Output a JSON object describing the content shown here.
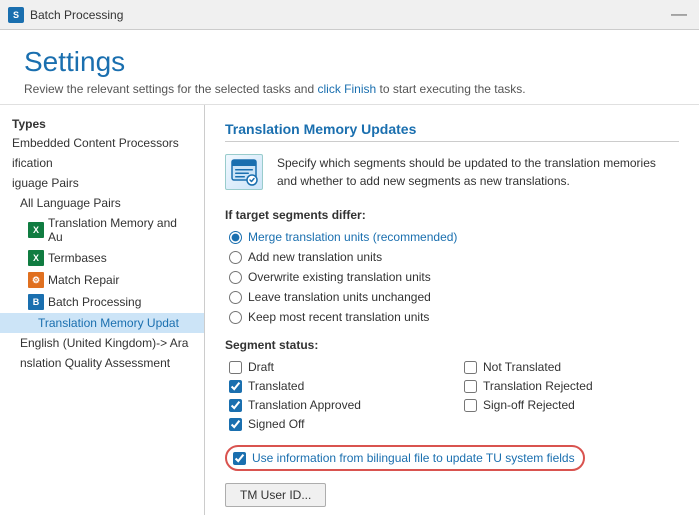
{
  "titlebar": {
    "icon_text": "S",
    "title": "Batch Processing",
    "close_label": "—"
  },
  "header": {
    "title": "Settings",
    "description_prefix": "Review the relevant settings for the selected tasks and ",
    "description_link": "click Finish",
    "description_suffix": " to start executing the tasks."
  },
  "sidebar": {
    "section_header": "Types",
    "items": [
      {
        "id": "embedded",
        "label": "Embedded Content Processors",
        "icon": "none",
        "indent": 0
      },
      {
        "id": "verification",
        "label": "ification",
        "icon": "none",
        "indent": 0
      },
      {
        "id": "language-pairs",
        "label": "iguage Pairs",
        "icon": "none",
        "indent": 0
      },
      {
        "id": "all-language-pairs",
        "label": "All Language Pairs",
        "icon": "none",
        "indent": 4
      },
      {
        "id": "tm-and-au",
        "label": "Translation Memory and Au",
        "icon": "excel",
        "indent": 8
      },
      {
        "id": "termbases",
        "label": "Termbases",
        "icon": "excel",
        "indent": 8
      },
      {
        "id": "match-repair",
        "label": "Match Repair",
        "icon": "orange",
        "indent": 8
      },
      {
        "id": "batch-processing",
        "label": "Batch Processing",
        "icon": "blue",
        "indent": 8
      },
      {
        "id": "tm-update",
        "label": "Translation Memory Updat",
        "icon": "none",
        "indent": 12,
        "active": true
      },
      {
        "id": "english-uk",
        "label": "English (United Kingdom)-> Ara",
        "icon": "none",
        "indent": 4
      },
      {
        "id": "translation-quality",
        "label": "nslation Quality Assessment",
        "icon": "none",
        "indent": 4
      }
    ]
  },
  "content": {
    "title": "Translation Memory Updates",
    "description": "Specify which segments should be updated to the translation memories and whether to add new segments as new translations.",
    "if_target_differs_label": "If target segments differ:",
    "radio_options": [
      {
        "id": "merge",
        "label": "Merge translation units (recommended)",
        "checked": true,
        "blue": true
      },
      {
        "id": "add-new",
        "label": "Add new translation units",
        "checked": false
      },
      {
        "id": "overwrite",
        "label": "Overwrite existing translation units",
        "checked": false
      },
      {
        "id": "leave",
        "label": "Leave translation units unchanged",
        "checked": false
      },
      {
        "id": "keep-recent",
        "label": "Keep most recent translation units",
        "checked": false
      }
    ],
    "segment_status_label": "Segment status:",
    "checkboxes": [
      {
        "id": "draft",
        "label": "Draft",
        "checked": false
      },
      {
        "id": "not-translated",
        "label": "Not Translated",
        "checked": false
      },
      {
        "id": "translated",
        "label": "Translated",
        "checked": true
      },
      {
        "id": "translation-rejected",
        "label": "Translation Rejected",
        "checked": false
      },
      {
        "id": "translation-approved",
        "label": "Translation Approved",
        "checked": true
      },
      {
        "id": "signoff-rejected",
        "label": "Sign-off Rejected",
        "checked": false
      },
      {
        "id": "signed-off",
        "label": "Signed Off",
        "checked": true
      }
    ],
    "bilingual_checkbox": {
      "label": "Use information from bilingual file to update TU system fields",
      "checked": true
    },
    "tm_user_button": "TM User ID..."
  }
}
